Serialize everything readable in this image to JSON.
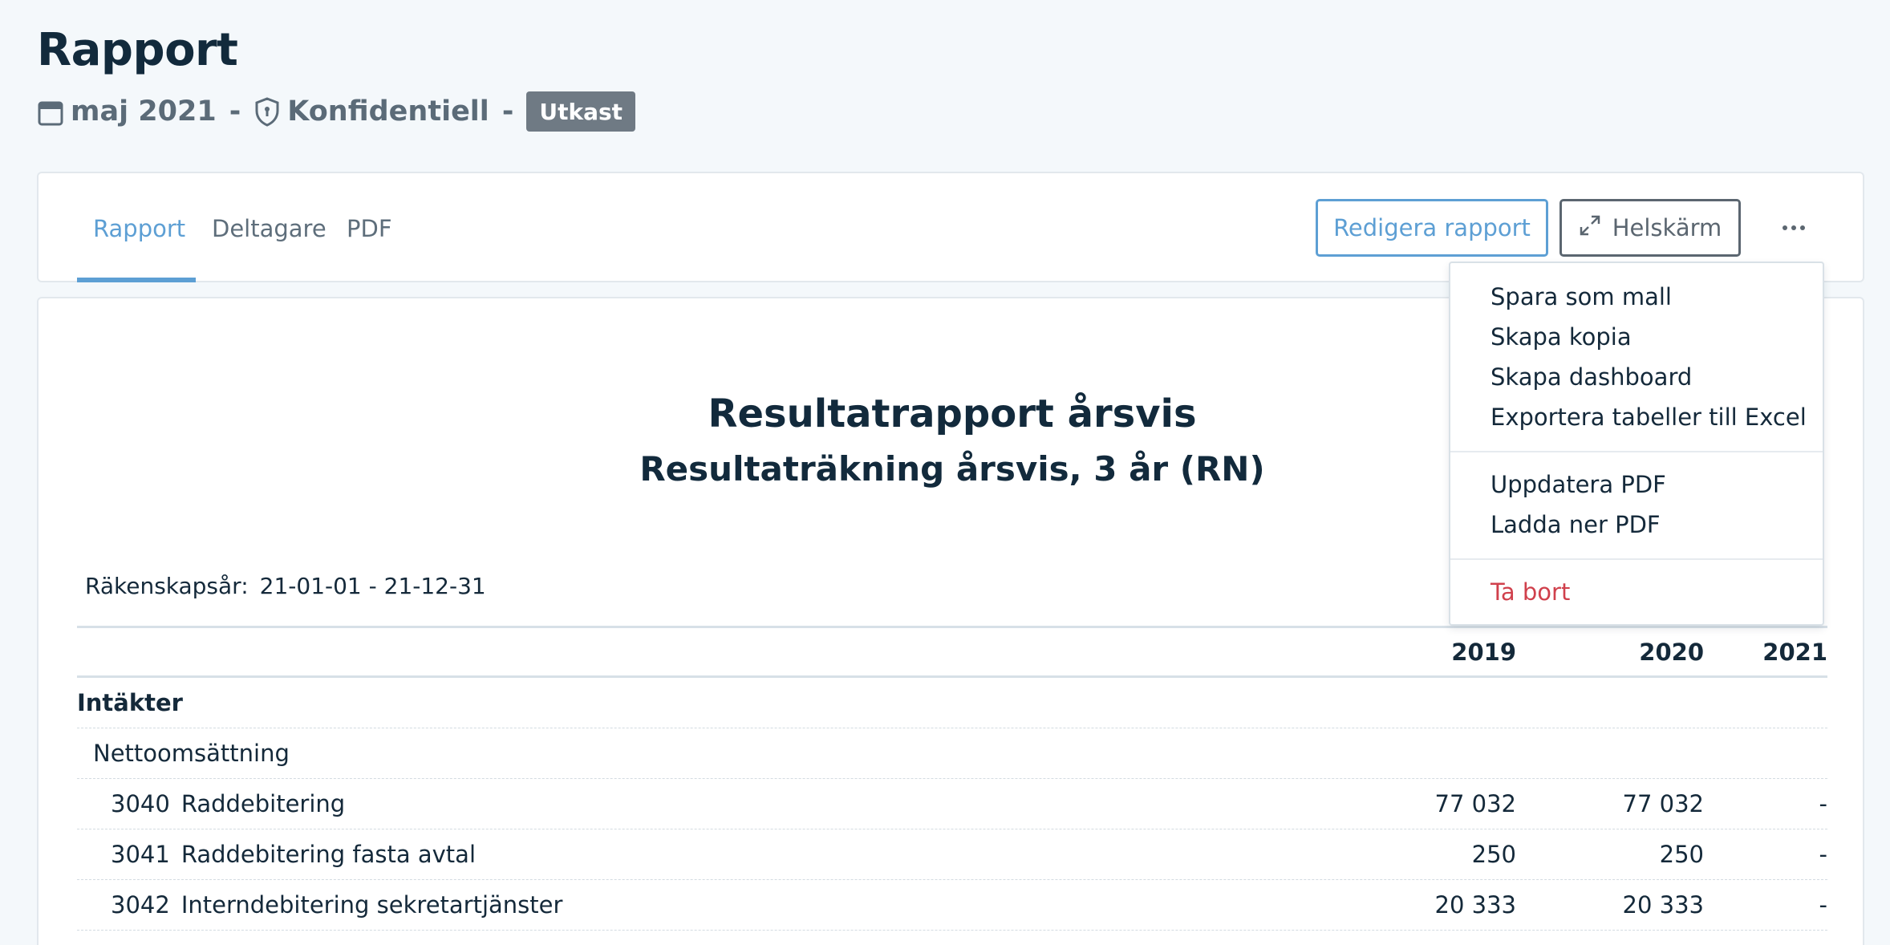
{
  "header": {
    "title": "Rapport",
    "date": "maj 2021",
    "separator": "-",
    "classification": "Konfidentiell",
    "status_badge": "Utkast"
  },
  "tabs": [
    {
      "label": "Rapport",
      "active": true
    },
    {
      "label": "Deltagare",
      "active": false
    },
    {
      "label": "PDF",
      "active": false
    }
  ],
  "toolbar": {
    "edit_label": "Redigera rapport",
    "fullscreen_label": "Helskärm"
  },
  "menu": {
    "items": [
      "Spara som mall",
      "Skapa kopia",
      "Skapa dashboard",
      "Exportera tabeller till Excel"
    ],
    "pdf_items": [
      "Uppdatera PDF",
      "Ladda ner PDF"
    ],
    "delete_label": "Ta bort"
  },
  "report": {
    "title": "Resultatrapport årsvis",
    "subtitle": "Resultaträkning årsvis, 3 år (RN)",
    "fiscal_label": "Räkenskapsår:",
    "fiscal_value": "21-01-01 - 21-12-31",
    "columns": [
      "2019",
      "2020",
      "2021"
    ],
    "group": "Intäkter",
    "subgroup": "Nettoomsättning",
    "rows": [
      {
        "account": "3040",
        "name": "Raddebitering",
        "values": [
          "77 032",
          "77 032",
          "-"
        ]
      },
      {
        "account": "3041",
        "name": "Raddebitering fasta avtal",
        "values": [
          "250",
          "250",
          "-"
        ]
      },
      {
        "account": "3042",
        "name": "Interndebitering sekretartjänster",
        "values": [
          "20 333",
          "20 333",
          "-"
        ]
      }
    ]
  },
  "colors": {
    "accent": "#5d9fd4",
    "text": "#14293a",
    "muted": "#5b6b78",
    "badge": "#6f7a84",
    "danger": "#d0404c",
    "background": "#f4f8fb"
  }
}
